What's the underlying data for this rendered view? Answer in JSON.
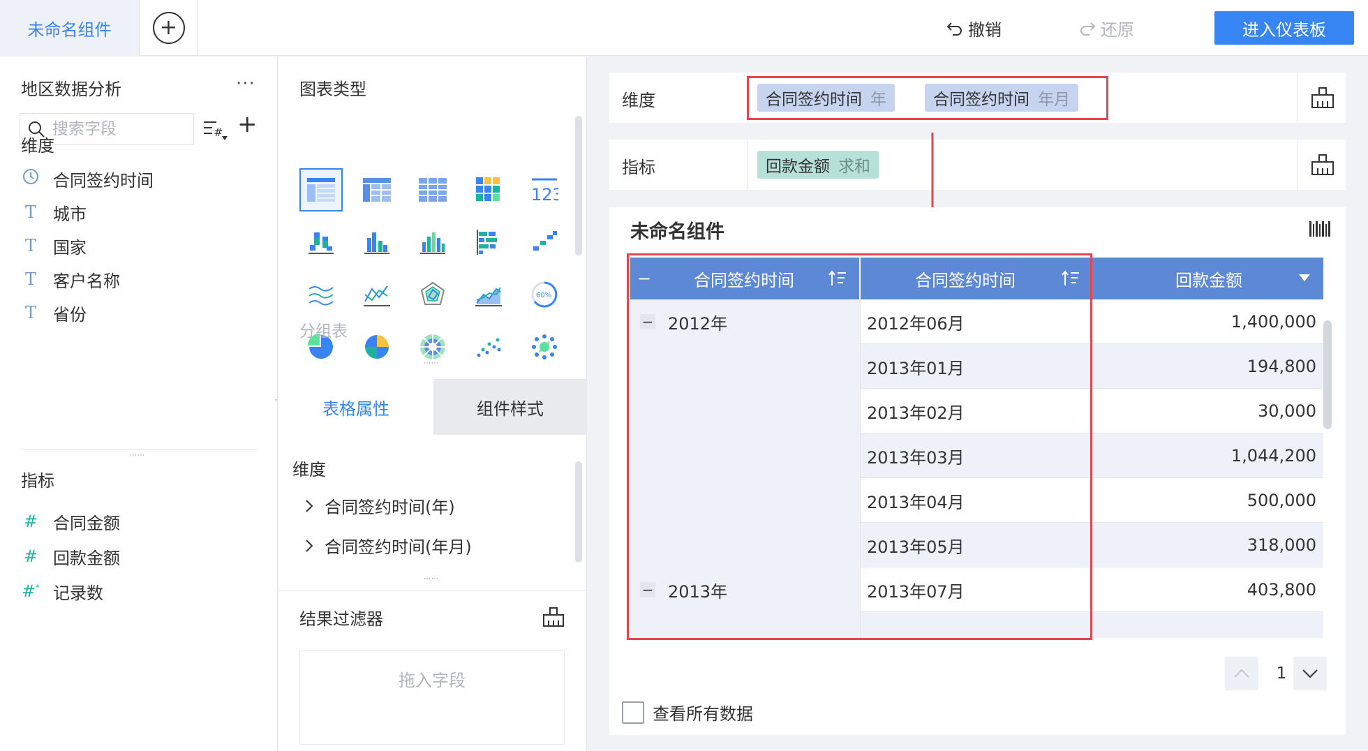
{
  "topbar": {
    "active_tab": "未命名组件",
    "undo_label": "撤销",
    "redo_label": "还原",
    "enter_dashboard": "进入仪表板"
  },
  "field_panel": {
    "dataset_title": "地区数据分析",
    "search_placeholder": "搜索字段",
    "dimension_label": "维度",
    "dimensions": [
      {
        "label": "合同签约时间",
        "icon": "clock-icon"
      },
      {
        "label": "城市",
        "icon": "text-type-icon"
      },
      {
        "label": "国家",
        "icon": "text-type-icon"
      },
      {
        "label": "客户名称",
        "icon": "text-type-icon"
      },
      {
        "label": "省份",
        "icon": "text-type-icon"
      }
    ],
    "measure_label": "指标",
    "measures": [
      {
        "label": "合同金额",
        "icon": "number-type-icon"
      },
      {
        "label": "回款金额",
        "icon": "number-type-icon"
      },
      {
        "label": "记录数",
        "icon": "count-type-icon"
      }
    ]
  },
  "chart_panel": {
    "title": "图表类型",
    "selected_type_label": "分组表",
    "tabs": {
      "table_props": "表格属性",
      "widget_style": "组件样式"
    },
    "props_dimension_label": "维度",
    "props_items": [
      "合同签约时间(年)",
      "合同签约时间(年月)"
    ],
    "filter_title": "结果过滤器",
    "drop_hint": "拖入字段"
  },
  "shelves": {
    "dimension_label": "维度",
    "dimension_pills": [
      {
        "name": "合同签约时间",
        "sub": "年"
      },
      {
        "name": "合同签约时间",
        "sub": "年月"
      }
    ],
    "measure_label": "指标",
    "measure_pills": [
      {
        "name": "回款金额",
        "sub": "求和"
      }
    ]
  },
  "widget": {
    "title": "未命名组件",
    "columns": [
      "合同签约时间",
      "合同签约时间",
      "回款金额"
    ],
    "groups": [
      {
        "label": "2012年",
        "collapse_symbol": "−"
      },
      {
        "label": "2013年",
        "collapse_symbol": "−"
      }
    ],
    "rows": [
      {
        "month": "2012年06月",
        "amount": "1,400,000"
      },
      {
        "month": "2013年01月",
        "amount": "194,800"
      },
      {
        "month": "2013年02月",
        "amount": "30,000"
      },
      {
        "month": "2013年03月",
        "amount": "1,044,200"
      },
      {
        "month": "2013年04月",
        "amount": "500,000"
      },
      {
        "month": "2013年05月",
        "amount": "318,000"
      },
      {
        "month": "2013年07月",
        "amount": "403,800"
      }
    ],
    "page": "1",
    "see_all_label": "查看所有数据"
  },
  "colors": {
    "accent": "#3685f2",
    "header_blue": "#5c88d6",
    "dimension_pill": "#c7d4ef",
    "measure_pill": "#b6e1d8",
    "highlight_red": "#e5454d"
  }
}
